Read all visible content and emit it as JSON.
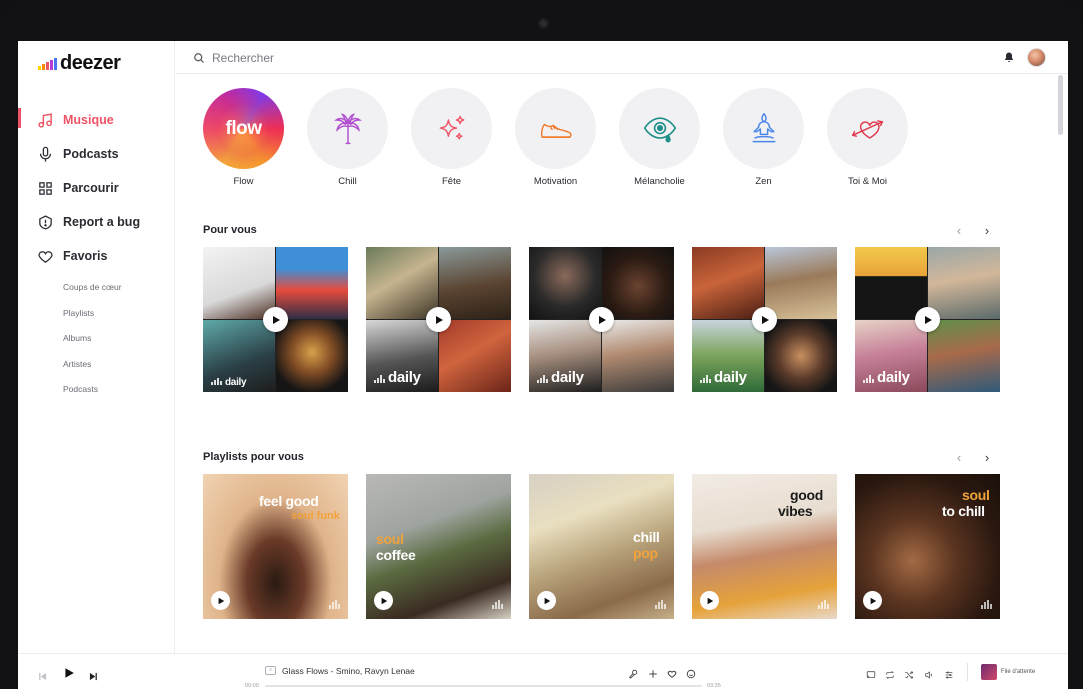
{
  "app": {
    "logo": "deezer",
    "logo_bar_colors": [
      "#ffd400",
      "#ff8a00",
      "#ef5466",
      "#b33cd6",
      "#4b72f0"
    ],
    "accent": "#ef5466"
  },
  "sidebar": {
    "items": [
      {
        "label": "Musique",
        "icon": "music-note-icon",
        "active": true
      },
      {
        "label": "Podcasts",
        "icon": "microphone-icon"
      },
      {
        "label": "Parcourir",
        "icon": "grid-icon"
      },
      {
        "label": "Report a bug",
        "icon": "bug-icon"
      },
      {
        "label": "Favoris",
        "icon": "heart-icon"
      }
    ],
    "subitems": [
      "Coups de cœur",
      "Playlists",
      "Albums",
      "Artistes",
      "Podcasts"
    ]
  },
  "search": {
    "placeholder": "Rechercher",
    "value": ""
  },
  "header": {
    "notification_icon": "bell-icon",
    "avatar_icon": "avatar"
  },
  "moods": [
    {
      "label": "Flow",
      "circle_text": "flow"
    },
    {
      "label": "Chill",
      "icon": "palm-tree-icon"
    },
    {
      "label": "Fête",
      "icon": "sparkles-icon"
    },
    {
      "label": "Motivation",
      "icon": "sneaker-icon"
    },
    {
      "label": "Mélancholie",
      "icon": "crying-eye-icon"
    },
    {
      "label": "Zen",
      "icon": "meditation-icon"
    },
    {
      "label": "Toi & Moi",
      "icon": "heart-arrow-icon"
    }
  ],
  "pour_vous": {
    "title": "Pour vous",
    "cards": [
      {
        "label": "daily"
      },
      {
        "label": "daily"
      },
      {
        "label": "daily"
      },
      {
        "label": "daily"
      },
      {
        "label": "daily"
      }
    ]
  },
  "playlists": {
    "title": "Playlists pour vous",
    "cards": [
      {
        "line1": "feel good",
        "line2": "soul funk",
        "color1": "#ffffff",
        "color2": "#f2a23a"
      },
      {
        "line1": "soul",
        "line2": "coffee",
        "color1": "#f2a23a",
        "color2": "#ffffff"
      },
      {
        "line1": "chill",
        "line2": "pop",
        "color1": "#ffffff",
        "color2": "#f2a23a"
      },
      {
        "line1": "good",
        "line2": "vibes",
        "color1": "#1a1a1a",
        "color2": "#1a1a1a"
      },
      {
        "line1": "soul",
        "line2": "to chill",
        "color1": "#f2a23a",
        "color2": "#ffffff"
      }
    ]
  },
  "player": {
    "track": "Glass Flows - Smino, Ravyn Lenae",
    "time_elapsed": "00:00",
    "time_total": "03:35",
    "progress": 0.0,
    "queue_label": "File d'attente"
  }
}
